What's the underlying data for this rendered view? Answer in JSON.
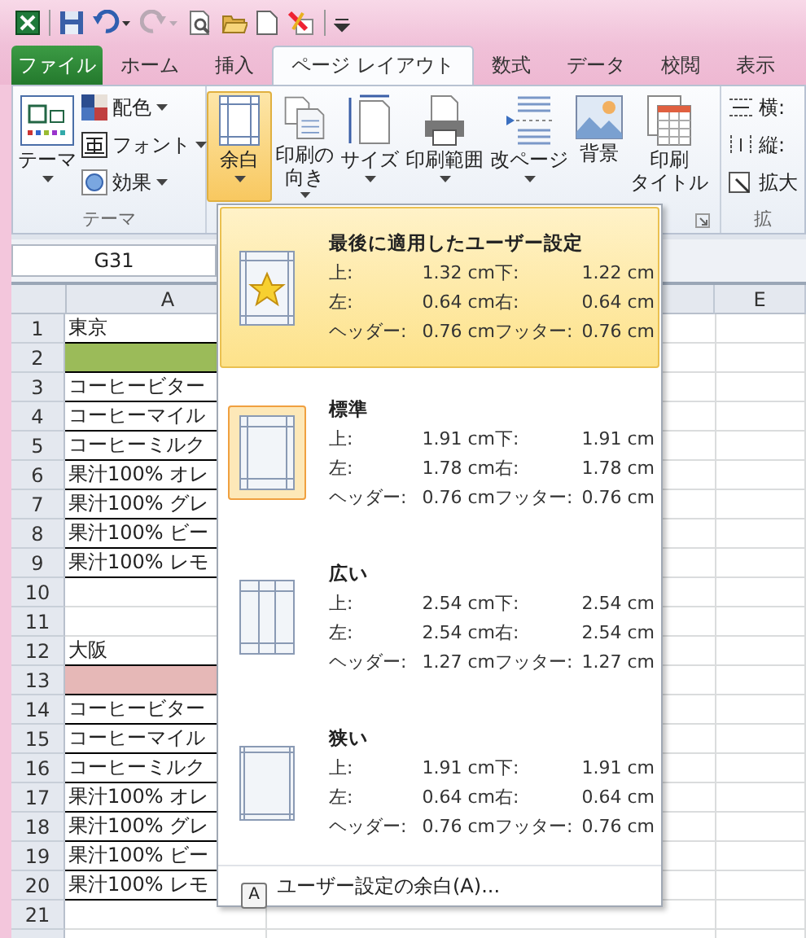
{
  "quick_access": [
    {
      "kind": "excel"
    },
    {
      "kind": "save"
    },
    {
      "kind": "undo",
      "disabled": false
    },
    {
      "kind": "redo",
      "disabled": true
    },
    {
      "kind": "preview"
    },
    {
      "kind": "open"
    },
    {
      "kind": "new"
    },
    {
      "kind": "custom"
    },
    {
      "kind": "customize"
    }
  ],
  "file_tab": "ファイル",
  "tabs": [
    {
      "label": "ホーム",
      "selected": false
    },
    {
      "label": "挿入",
      "selected": false
    },
    {
      "label": "ページ レイアウト",
      "selected": true
    },
    {
      "label": "数式",
      "selected": false
    },
    {
      "label": "データ",
      "selected": false
    },
    {
      "label": "校閲",
      "selected": false
    },
    {
      "label": "表示",
      "selected": false
    }
  ],
  "ribbon": {
    "theme_group": {
      "label": "テーマ",
      "big_button": "テーマ",
      "small_buttons": [
        {
          "kind": "colors",
          "label": "配色"
        },
        {
          "kind": "fonts",
          "label": "フォント"
        },
        {
          "kind": "effects",
          "label": "効果"
        }
      ]
    },
    "page_setup_buttons": [
      {
        "kind": "margins",
        "lines": [
          "余白"
        ],
        "pressed": true
      },
      {
        "kind": "orientation",
        "lines": [
          "印刷の",
          "向き"
        ],
        "pressed": false
      },
      {
        "kind": "size",
        "lines": [
          "サイズ"
        ],
        "pressed": false
      },
      {
        "kind": "area",
        "lines": [
          "印刷範囲"
        ],
        "pressed": false
      },
      {
        "kind": "breaks",
        "lines": [
          "改ページ"
        ],
        "pressed": false
      },
      {
        "kind": "background",
        "lines": [
          "背景"
        ],
        "pressed": false
      },
      {
        "kind": "titles",
        "lines": [
          "印刷",
          "タイトル"
        ],
        "pressed": false
      }
    ],
    "scale_group": {
      "label": "拡",
      "items": [
        {
          "kind": "width",
          "label": "横:"
        },
        {
          "kind": "height",
          "label": "縦:"
        },
        {
          "kind": "scale",
          "label": "拡大"
        }
      ]
    }
  },
  "name_box": "G31",
  "columns": [
    "A",
    "E"
  ],
  "rows": [
    {
      "n": "1",
      "a": "東京"
    },
    {
      "n": "2",
      "a": "",
      "color": "#9bbb59"
    },
    {
      "n": "3",
      "a": "コーヒービター"
    },
    {
      "n": "4",
      "a": "コーヒーマイル"
    },
    {
      "n": "5",
      "a": "コーヒーミルク"
    },
    {
      "n": "6",
      "a": "果汁100% オレ"
    },
    {
      "n": "7",
      "a": "果汁100% グレ"
    },
    {
      "n": "8",
      "a": "果汁100% ビー"
    },
    {
      "n": "9",
      "a": "果汁100% レモ"
    },
    {
      "n": "10",
      "a": ""
    },
    {
      "n": "11",
      "a": ""
    },
    {
      "n": "12",
      "a": "大阪"
    },
    {
      "n": "13",
      "a": "",
      "color": "#e6b8b7"
    },
    {
      "n": "14",
      "a": "コーヒービター"
    },
    {
      "n": "15",
      "a": "コーヒーマイル"
    },
    {
      "n": "16",
      "a": "コーヒーミルク"
    },
    {
      "n": "17",
      "a": "果汁100% オレ"
    },
    {
      "n": "18",
      "a": "果汁100% グレ"
    },
    {
      "n": "19",
      "a": "果汁100% ビー"
    },
    {
      "n": "20",
      "a": "果汁100% レモ"
    },
    {
      "n": "21",
      "a": ""
    }
  ],
  "margins_menu": {
    "items": [
      {
        "kind": "last",
        "title": "最後に適用したユーザー設定",
        "hovered": true,
        "selected": false,
        "values": [
          [
            "上:",
            "1.32 cm",
            "下:",
            "1.22 cm"
          ],
          [
            "左:",
            "0.64 cm",
            "右:",
            "0.64 cm"
          ],
          [
            "ヘッダー:",
            "0.76 cm",
            "フッター:",
            "0.76 cm"
          ]
        ]
      },
      {
        "kind": "normal",
        "title": "標準",
        "hovered": false,
        "selected": true,
        "values": [
          [
            "上:",
            "1.91 cm",
            "下:",
            "1.91 cm"
          ],
          [
            "左:",
            "1.78 cm",
            "右:",
            "1.78 cm"
          ],
          [
            "ヘッダー:",
            "0.76 cm",
            "フッター:",
            "0.76 cm"
          ]
        ]
      },
      {
        "kind": "wide",
        "title": "広い",
        "hovered": false,
        "selected": false,
        "values": [
          [
            "上:",
            "2.54 cm",
            "下:",
            "2.54 cm"
          ],
          [
            "左:",
            "2.54 cm",
            "右:",
            "2.54 cm"
          ],
          [
            "ヘッダー:",
            "1.27 cm",
            "フッター:",
            "1.27 cm"
          ]
        ]
      },
      {
        "kind": "narrow",
        "title": "狭い",
        "hovered": false,
        "selected": false,
        "values": [
          [
            "上:",
            "1.91 cm",
            "下:",
            "1.91 cm"
          ],
          [
            "左:",
            "0.64 cm",
            "右:",
            "0.64 cm"
          ],
          [
            "ヘッダー:",
            "0.76 cm",
            "フッター:",
            "0.76 cm"
          ]
        ]
      }
    ],
    "footer": {
      "label": "ユーザー設定の余白(A)...",
      "keytip": "A"
    }
  }
}
